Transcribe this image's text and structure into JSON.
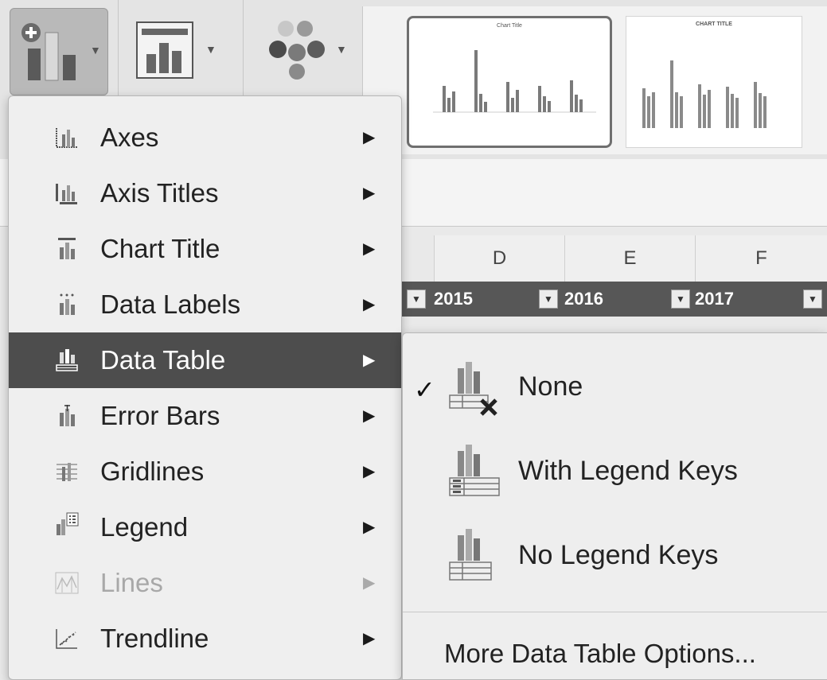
{
  "ribbon": {
    "add_chart_element_icon": "add-chart-element-icon",
    "quick_layout_icon": "quick-layout-icon",
    "change_colors_icon": "change-colors-icon",
    "styles": [
      {
        "title": "Chart Title"
      },
      {
        "title": "CHART TITLE"
      }
    ]
  },
  "sheet": {
    "columns": [
      "D",
      "E",
      "F"
    ],
    "years": [
      "2015",
      "2016",
      "2017"
    ]
  },
  "menu": {
    "items": [
      {
        "label": "Axes",
        "icon": "axes-icon",
        "enabled": true
      },
      {
        "label": "Axis Titles",
        "icon": "axis-titles-icon",
        "enabled": true
      },
      {
        "label": "Chart Title",
        "icon": "chart-title-icon",
        "enabled": true
      },
      {
        "label": "Data Labels",
        "icon": "data-labels-icon",
        "enabled": true
      },
      {
        "label": "Data Table",
        "icon": "data-table-icon",
        "enabled": true,
        "active": true
      },
      {
        "label": "Error Bars",
        "icon": "error-bars-icon",
        "enabled": true
      },
      {
        "label": "Gridlines",
        "icon": "gridlines-icon",
        "enabled": true
      },
      {
        "label": "Legend",
        "icon": "legend-icon",
        "enabled": true
      },
      {
        "label": "Lines",
        "icon": "lines-icon",
        "enabled": false
      },
      {
        "label": "Trendline",
        "icon": "trendline-icon",
        "enabled": true
      }
    ],
    "submenu_arrow": "▶"
  },
  "submenu": {
    "items": [
      {
        "label": "None",
        "checked": true,
        "icon": "data-table-none-icon"
      },
      {
        "label": "With Legend Keys",
        "checked": false,
        "icon": "data-table-with-legend-keys-icon"
      },
      {
        "label": "No Legend Keys",
        "checked": false,
        "icon": "data-table-no-legend-keys-icon"
      }
    ],
    "checkmark": "✓",
    "more_options": "More Data Table Options..."
  },
  "colors": {
    "active_item_bg": "#4d4d4d",
    "header_row_bg": "#575757",
    "menu_bg": "#efefef"
  }
}
